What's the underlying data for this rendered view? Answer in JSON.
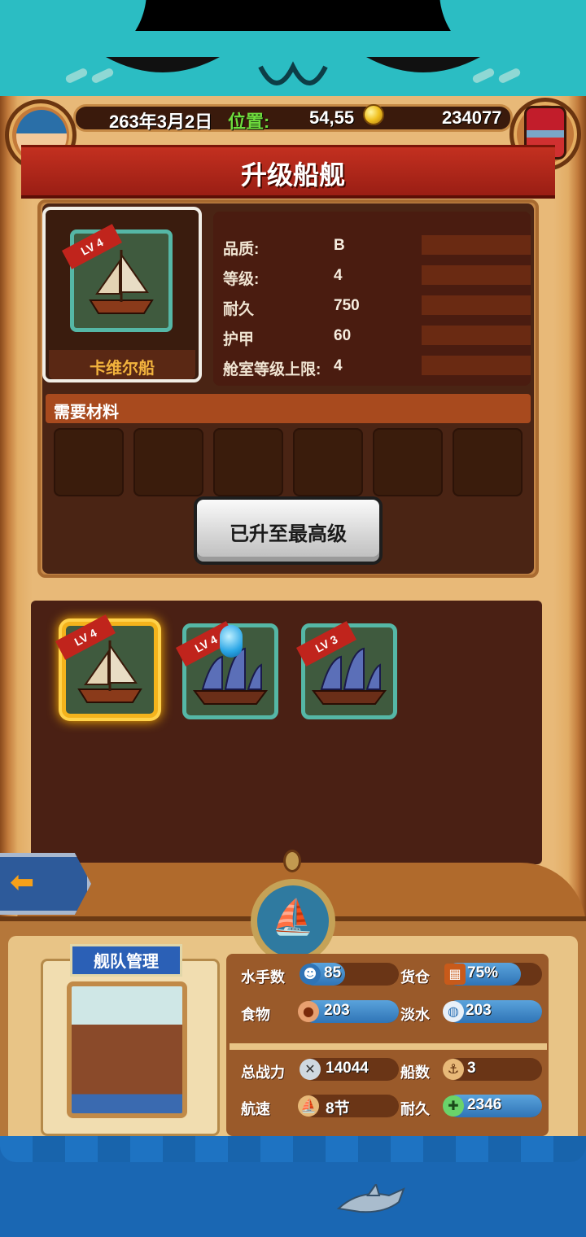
{
  "header": {
    "date": "263年3月2日",
    "position_label": "位置:",
    "position_value": "54,55",
    "gold": "234077"
  },
  "title": "升级船舰",
  "ship": {
    "level_badge": "LV 4",
    "name": "卡维尔船"
  },
  "stats": [
    {
      "label": "品质:",
      "value": "B"
    },
    {
      "label": "等级:",
      "value": "4"
    },
    {
      "label": "耐久",
      "value": "750"
    },
    {
      "label": "护甲",
      "value": "60"
    },
    {
      "label": "舱室等级上限:",
      "value": "4"
    }
  ],
  "materials": {
    "title": "需要材料",
    "slot_count": 6
  },
  "max_button_label": "已升至最高级",
  "ship_list": [
    {
      "level": "LV 4",
      "selected": true
    },
    {
      "level": "LV 4",
      "selected": false
    },
    {
      "level": "LV 3",
      "selected": false
    }
  ],
  "fleet": {
    "title": "舰队管理",
    "sailors_label": "水手数",
    "sailors_value": "85",
    "cargo_label": "货仓",
    "cargo_value": "75%",
    "food_label": "食物",
    "food_value": "203",
    "water_label": "淡水",
    "water_value": "203",
    "power_label": "总战力",
    "power_value": "14044",
    "ships_label": "船数",
    "ships_value": "3",
    "speed_label": "航速",
    "speed_value": "8节",
    "durability_label": "耐久",
    "durability_value": "2346"
  },
  "colors": {
    "teal": "#2bbdc3",
    "wood": "#e8b978",
    "ribbon_red": "#c33020",
    "tile_border": "#55b7a6",
    "stat_blue": "#2f74b6",
    "position_green": "#6fdc3d",
    "gold_text": "#f2b33d"
  },
  "icons": [
    "gold-coin-icon",
    "treasure-chest-icon",
    "back-arrow-icon",
    "ship-helm-icon",
    "sailor-icon",
    "cargo-icon",
    "food-icon",
    "water-icon",
    "swords-icon",
    "ship-count-icon",
    "speed-icon",
    "durability-icon",
    "shark-icon"
  ]
}
